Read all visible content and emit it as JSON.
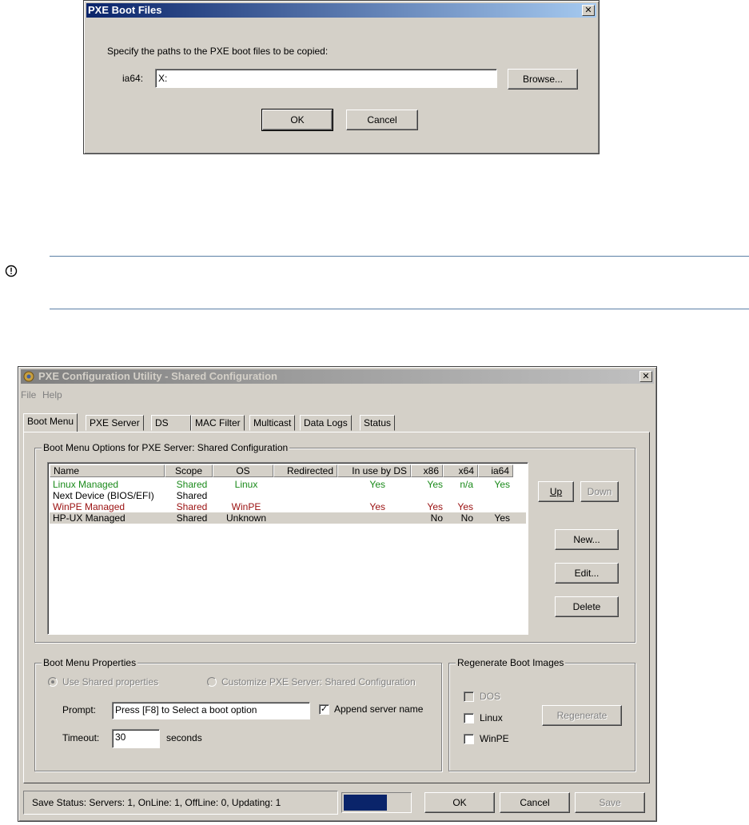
{
  "pxe_boot_files": {
    "title": "PXE Boot Files",
    "instruction": "Specify the paths to the PXE boot files to be copied:",
    "ia64_label": "ia64:",
    "ia64_value": "X:",
    "browse_label": "Browse...",
    "ok_label": "OK",
    "cancel_label": "Cancel"
  },
  "note": {
    "icon": "info-circle-icon"
  },
  "pxe_util": {
    "title": "PXE Configuration Utility - Shared Configuration",
    "menu": [
      "File",
      "Help"
    ],
    "tabs": [
      "Boot Menu",
      "PXE Server",
      "DS",
      "MAC Filter",
      "Multicast",
      "Data Logs",
      "Status"
    ],
    "options_group": "Boot Menu Options for PXE Server:  Shared Configuration",
    "columns": [
      "Name",
      "Scope",
      "OS",
      "Redirected",
      "In use by DS",
      "x86",
      "x64",
      "ia64"
    ],
    "rows": [
      {
        "name": "Linux Managed",
        "scope": "Shared",
        "os": "Linux",
        "redirected": "",
        "in_use": "Yes",
        "x86": "Yes",
        "x64": "n/a",
        "ia64": "Yes",
        "color": "#1a8a1a"
      },
      {
        "name": "Next Device (BIOS/EFI)",
        "scope": "Shared",
        "os": "",
        "redirected": "",
        "in_use": "",
        "x86": "",
        "x64": "",
        "ia64": "",
        "color": "#000000"
      },
      {
        "name": "WinPE Managed",
        "scope": "Shared",
        "os": "WinPE",
        "redirected": "",
        "in_use": "Yes",
        "x86": "Yes",
        "x64": "Yes",
        "ia64": "",
        "color": "#9a1010"
      },
      {
        "name": "HP-UX Managed",
        "scope": "Shared",
        "os": "Unknown",
        "redirected": "",
        "in_use": "",
        "x86": "No",
        "x64": "No",
        "ia64": "Yes",
        "color": "#000000"
      }
    ],
    "up_label": "Up",
    "down_label": "Down",
    "new_label": "New...",
    "edit_label": "Edit...",
    "delete_label": "Delete",
    "props_group": "Boot Menu Properties",
    "use_shared": "Use Shared properties",
    "customize": "Customize PXE Server:  Shared Configuration",
    "prompt_label": "Prompt:",
    "prompt_value": "Press [F8] to Select a boot option",
    "append_label": "Append server name",
    "timeout_label": "Timeout:",
    "timeout_value": "30",
    "seconds_label": "seconds",
    "regen_group": "Regenerate Boot Images",
    "dos_label": "DOS",
    "linux_label": "Linux",
    "winpe_label": "WinPE",
    "regenerate_label": "Regenerate",
    "status_text": "Save Status:  Servers: 1,  OnLine: 1,  OffLine: 0,  Updating: 1",
    "ok_label": "OK",
    "cancel_label": "Cancel",
    "save_label": "Save"
  }
}
